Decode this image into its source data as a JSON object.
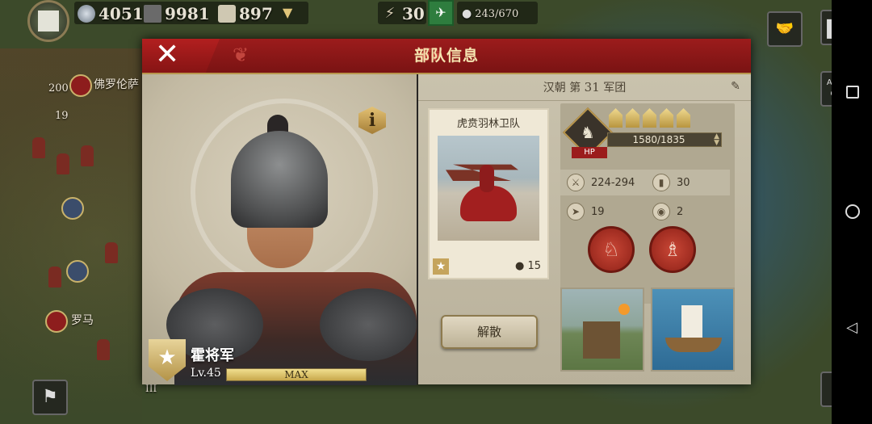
{
  "top_bar": {
    "resource1": "4051",
    "resource2": "9981",
    "resource3": "897",
    "bolt_count": "30",
    "army_pop": "243/670"
  },
  "map": {
    "label_florence": "佛罗伦萨",
    "label_rome": "罗马",
    "count_a": "200",
    "count_b": "19",
    "roman_three": "III",
    "auto_label_top": "AUTO",
    "auto_label_bottom": "OFF"
  },
  "dialog": {
    "title": "部队信息",
    "close_glyph": "✕",
    "general": {
      "name": "霍将军",
      "level": "Lv.45",
      "xp_label": "MAX",
      "xp_fraction": 1.0
    },
    "info_glyph": "i",
    "corps": {
      "prefix": "汉朝 第",
      "number": "31",
      "suffix": "军团"
    },
    "unit": {
      "name": "虎贲羽林卫队",
      "count": "15"
    },
    "dismiss_label": "解散",
    "hp_label": "HP",
    "hp_text": "1580/1835",
    "hp_fraction": 0.861,
    "medals": 5,
    "stats": {
      "attack": "224-294",
      "defense": "30",
      "move": "19",
      "vision": "2"
    }
  },
  "icons": [
    "emblem-icon",
    "coin-icon",
    "hammer-icon",
    "scroll-icon",
    "chevron-down-icon",
    "bolt-icon",
    "dove-icon",
    "person-icon",
    "handshake-icon",
    "pause-icon",
    "auto-icon",
    "swap-icon",
    "close-icon",
    "info-icon",
    "edit-icon",
    "star-icon",
    "person-count-icon",
    "unit-horse-icon",
    "medal-icon",
    "attack-icon",
    "defense-icon",
    "move-icon",
    "vision-icon",
    "charge-skill-icon",
    "rally-skill-icon",
    "catapult-icon",
    "ship-icon",
    "nav-square-icon",
    "nav-circle-icon",
    "nav-back-icon"
  ],
  "colors": {
    "header_red": "#9c1c1c",
    "accent_gold": "#b8954c",
    "xp_gold": "#e8d282"
  }
}
